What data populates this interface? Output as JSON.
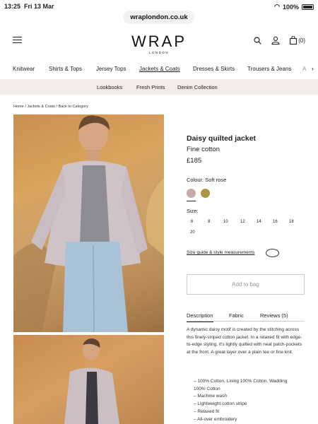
{
  "status_bar": {
    "time": "13:25",
    "date": "Fri 13 Mar",
    "battery": "100%"
  },
  "browser": {
    "url": "wraplondon.co.uk"
  },
  "header": {
    "logo": "WRAP",
    "logo_sub": "LONDON",
    "bag_count": "(0)"
  },
  "category_nav": [
    "Knitwear",
    "Shirts & Tops",
    "Jersey Tops",
    "Jackets & Coats",
    "Dresses & Skirts",
    "Trousers & Jeans",
    "A"
  ],
  "sub_nav": [
    "Lookbooks",
    "Fresh Prints",
    "Denim Collection"
  ],
  "breadcrumb": "Home / Jackets & Coats / Back to Category",
  "product": {
    "title": "Daisy quilted jacket",
    "subtitle": "Fine cotton",
    "price": "£185",
    "colour_label": "Colour: Soft rose",
    "swatches": [
      "#c5aaa8",
      "#ad9548"
    ],
    "size_label": "Size:",
    "sizes": [
      "6",
      "8",
      "10",
      "12",
      "14",
      "16",
      "18",
      "20"
    ],
    "size_guide": "Size guide & style measurements",
    "add_to_bag": "Add to bag"
  },
  "tabs": [
    "Description",
    "Fabric",
    "Reviews (5)"
  ],
  "description": "A dynamic daisy motif is created by the stitching across this finely-striped cotton jacket. In a relaxed fit with edge-to-edge styling, it's lightly quilted with neat patch-pockets at the front. A great layer over a plain tee or fine knit.",
  "features": [
    "100% Cotton, Lining 100% Cotton, Wadding",
    "100% Cotton",
    "Machine wash",
    "Lightweight cotton stripe",
    "Relaxed fit",
    "All-over embroidery"
  ]
}
